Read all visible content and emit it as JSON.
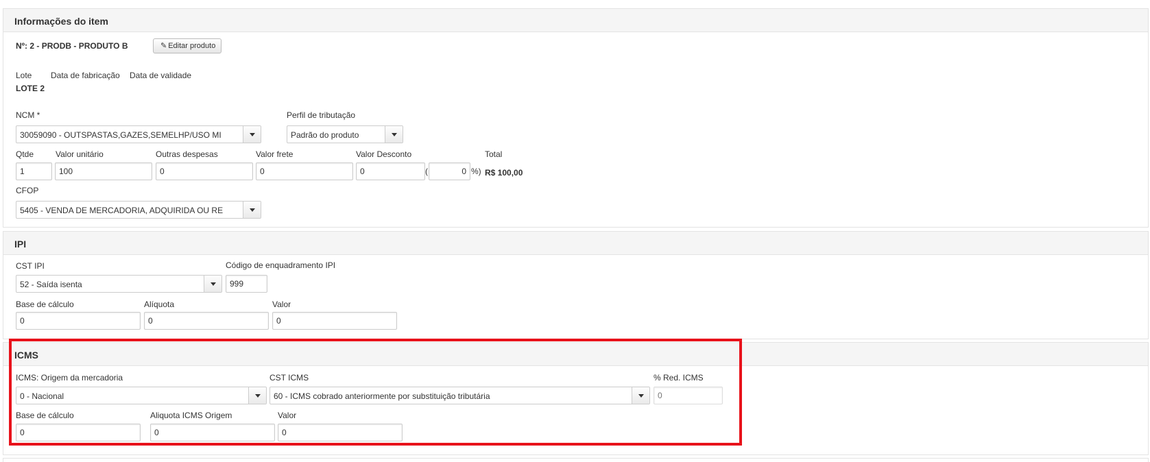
{
  "item": {
    "header": "Informações do item",
    "product_line": "Nº: 2 - PRODB - PRODUTO B",
    "edit_button": "Editar produto",
    "lot_label": "Lote",
    "mfg_date_label": "Data de fabricação",
    "exp_date_label": "Data de validade",
    "lot_value": "LOTE 2",
    "ncm_label": "NCM *",
    "ncm_value": "30059090 - OUTSPASTAS,GAZES,SEMELHP/USO MI",
    "tax_profile_label": "Perfil de tributação",
    "tax_profile_value": "Padrão do produto",
    "qty_label": "Qtde",
    "qty_value": "1",
    "unit_value_label": "Valor unitário",
    "unit_value": "100",
    "other_exp_label": "Outras despesas",
    "other_exp_value": "0",
    "freight_label": "Valor frete",
    "freight_value": "0",
    "discount_label": "Valor Desconto",
    "discount_value": "0",
    "discount_pct_open": "(",
    "discount_pct_value": "0",
    "discount_pct_close": "%)",
    "total_label": "Total",
    "total_value": "R$ 100,00",
    "cfop_label": "CFOP",
    "cfop_value": "5405 - VENDA DE MERCADORIA, ADQUIRIDA OU RE"
  },
  "ipi": {
    "header": "IPI",
    "cst_label": "CST IPI",
    "cst_value": "52 - Saída isenta",
    "code_label": "Código de enquadramento IPI",
    "code_value": "999",
    "base_label": "Base de cálculo",
    "base_value": "0",
    "rate_label": "Alíquota",
    "rate_value": "0",
    "value_label": "Valor",
    "value_value": "0"
  },
  "icms": {
    "header": "ICMS",
    "origin_label": "ICMS: Origem da mercadoria",
    "origin_value": "0 - Nacional",
    "cst_label": "CST ICMS",
    "cst_value": "60 - ICMS cobrado anteriormente por substituição tributária",
    "red_label": "% Red. ICMS",
    "red_placeholder": "0",
    "base_label": "Base de cálculo",
    "base_value": "0",
    "rate_label": "Aliquota ICMS Origem",
    "rate_value": "0",
    "value_label": "Valor",
    "value_value": "0"
  },
  "colors": {
    "highlight": "#e8121b"
  },
  "icons": {
    "edit": "pencil-icon",
    "dropdown": "caret-down-icon"
  }
}
